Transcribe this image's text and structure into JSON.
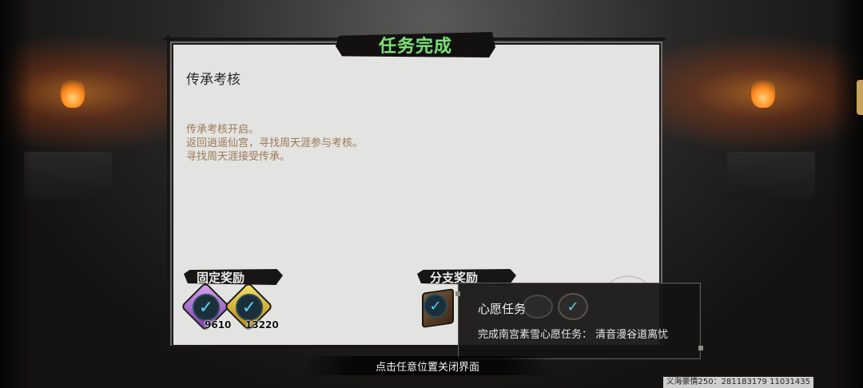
{
  "dialog": {
    "title": "任务完成",
    "task_name": "传承考核",
    "description_lines": [
      "传承考核开启。",
      "返回逍遥仙宫，寻找周天涯参与考核。",
      "寻找周天涯接受传承。"
    ],
    "fixed_reward_label": "固定奖励",
    "branch_reward_label": "分支奖励",
    "fixed_rewards": [
      {
        "icon": "purple-gem-icon",
        "quantity": "9610"
      },
      {
        "icon": "gold-gem-icon",
        "quantity": "13220"
      }
    ],
    "branch_reward_icon": "book-icon"
  },
  "tooltip": {
    "title": "心愿任务",
    "body": "完成南宫素雪心愿任务：  清音漫谷道离忧"
  },
  "footer": {
    "close_hint": "点击任意位置关闭界面"
  },
  "watermark": "义海豪情250：281183179  11031435",
  "colors": {
    "title_green": "#7ee070",
    "description_brown": "#9b7a55",
    "panel_bg": "#e3e3e1"
  }
}
